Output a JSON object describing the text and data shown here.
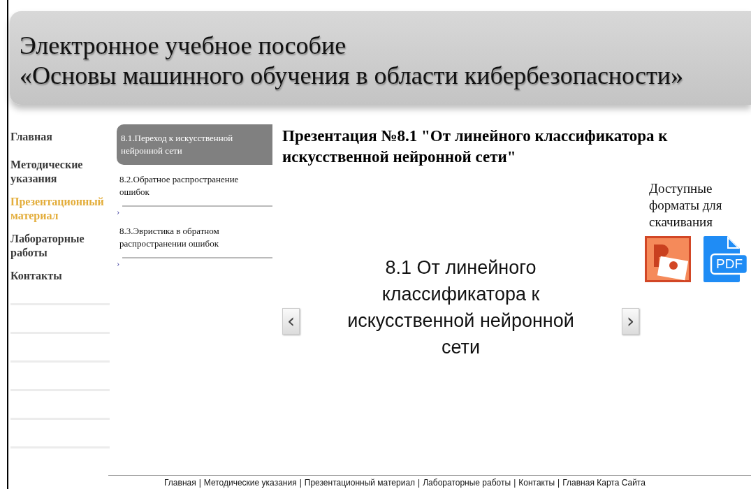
{
  "header": {
    "title_line_1": "Электронное учебное пособие",
    "title_line_2": "«Основы машинного обучения в области кибербезопасности»"
  },
  "sidebar": {
    "items": [
      {
        "label": "Главная",
        "selected": false
      },
      {
        "label": "Методические указания",
        "selected": false
      },
      {
        "label": "Презентационный материал",
        "selected": true
      },
      {
        "label": "Лабораторные работы",
        "selected": false
      },
      {
        "label": "Контакты",
        "selected": false
      }
    ]
  },
  "submenu": {
    "items": [
      {
        "label": "8.1.Переход к искусственной нейронной сети",
        "selected": true
      },
      {
        "label": "8.2.Обратное распространение ошибок",
        "selected": false,
        "chevron": "›"
      },
      {
        "label": "8.3.Эвристика в обратном распространении ошибок",
        "selected": false,
        "chevron": "›"
      }
    ]
  },
  "main": {
    "title": "Презентация №8.1 \"От линейного классификатора к искусственной нейронной сети\"",
    "slide": {
      "text": "8.1 От линейного классификатора к искусственной нейронной сети",
      "prev": "‹",
      "next": "›"
    },
    "downloads": {
      "label": "Доступные форматы для скачивания",
      "formats": [
        {
          "kind": "ppt"
        },
        {
          "kind": "pdf",
          "label": "PDF"
        }
      ]
    }
  },
  "footer": {
    "links": [
      "Главная",
      "Методические указания",
      "Презентационный материал",
      "Лабораторные работы",
      "Контакты",
      "Главная Карта Сайта"
    ],
    "separator": "|"
  }
}
